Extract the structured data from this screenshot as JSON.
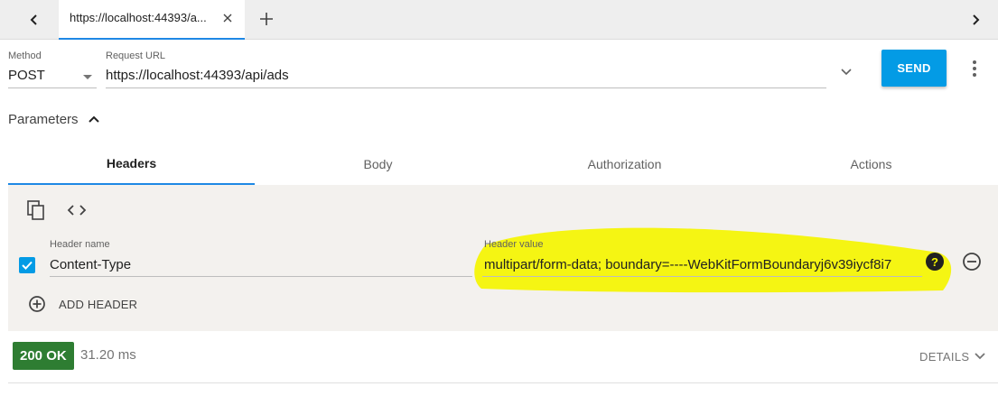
{
  "tab": {
    "title": "https://localhost:44393/a...",
    "close_glyph": "✕",
    "add_glyph": "+"
  },
  "request": {
    "method_label": "Method",
    "method_value": "POST",
    "url_label": "Request URL",
    "url_value": "https://localhost:44393/api/ads",
    "send_label": "SEND"
  },
  "parameters": {
    "label": "Parameters",
    "tabs": [
      {
        "label": "Headers"
      },
      {
        "label": "Body"
      },
      {
        "label": "Authorization"
      },
      {
        "label": "Actions"
      }
    ],
    "active_tab": "Headers"
  },
  "headers_editor": {
    "name_label": "Header name",
    "value_label": "Header value",
    "rows": [
      {
        "enabled": true,
        "name": "Content-Type",
        "value": "multipart/form-data; boundary=----WebKitFormBoundaryj6v39iycf8i7"
      }
    ],
    "help_glyph": "?",
    "add_label": "ADD HEADER"
  },
  "response": {
    "status": "200 OK",
    "time": "31.20 ms",
    "details_label": "DETAILS"
  },
  "colors": {
    "accent": "#039be5",
    "tab_underline": "#1e88e5",
    "status_ok": "#2e7d32",
    "highlight": "#f5f500",
    "panel_bg": "#f3f1ee"
  },
  "icons": {
    "nav_prev": "chevron-left-icon",
    "nav_next": "chevron-right-icon",
    "url_expand": "chevron-down-icon",
    "more": "more-vert-icon",
    "params_toggle": "chevron-up-icon",
    "copy": "copy-icon",
    "code": "code-icon",
    "remove": "remove-circle-icon",
    "add": "add-circle-icon",
    "details": "chevron-down-icon"
  }
}
